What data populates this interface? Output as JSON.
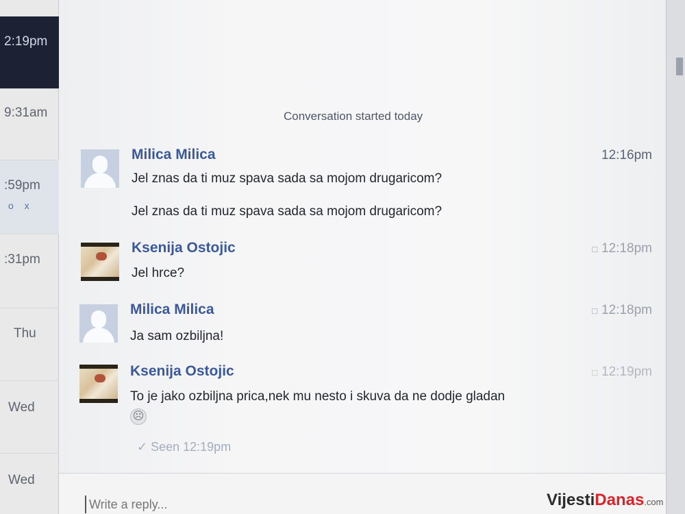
{
  "left_list": {
    "items": [
      {
        "time": "2:19pm"
      },
      {
        "time": "9:31am"
      },
      {
        "time": ":59pm"
      },
      {
        "time": ":31pm"
      },
      {
        "time": "Thu"
      },
      {
        "time": "Wed"
      },
      {
        "time": "Wed"
      }
    ],
    "actions": "o x"
  },
  "conversation": {
    "started_label": "Conversation started today",
    "messages": [
      {
        "sender": "Milica Milica",
        "time": "12:16pm",
        "lines": [
          "Jel znas da ti muz spava sada sa mojom drugaricom?",
          "Jel znas da ti muz spava sada sa mojom drugaricom?"
        ]
      },
      {
        "sender": "Ksenija Ostojic",
        "time": "12:18pm",
        "lines": [
          "Jel hrce?"
        ]
      },
      {
        "sender": "Milica Milica",
        "time": "12:18pm",
        "lines": [
          "Ja sam ozbiljna!"
        ]
      },
      {
        "sender": "Ksenija Ostojic",
        "time": "12:19pm",
        "lines": [
          "To je jako ozbiljna prica,nek mu nesto i skuva da ne dodje gladan"
        ]
      }
    ],
    "seen_label": "Seen 12:19pm"
  },
  "reply": {
    "placeholder": "Write a reply..."
  },
  "watermark": {
    "part1": "Vijesti",
    "part2": "Danas",
    "part3": ".com"
  }
}
